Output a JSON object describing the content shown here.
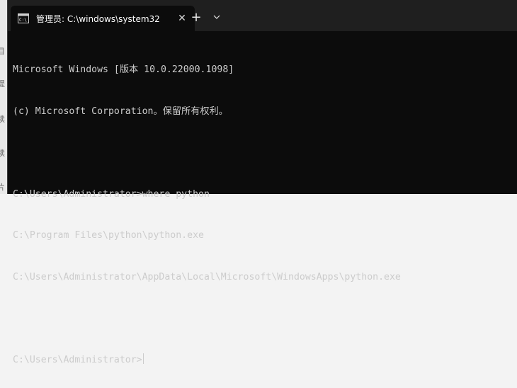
{
  "window": {
    "tab_title": "管理员: C:\\windows\\system32",
    "tab_close_icon": "close-icon",
    "new_tab_label": "+",
    "dropdown_icon": "chevron-down-icon"
  },
  "console": {
    "lines": [
      "Microsoft Windows [版本 10.0.22000.1098]",
      "(c) Microsoft Corporation。保留所有权利。",
      "",
      "C:\\Users\\Administrator>where python",
      "C:\\Program Files\\python\\python.exe",
      "C:\\Users\\Administrator\\AppData\\Local\\Microsoft\\WindowsApps\\python.exe",
      "",
      "C:\\Users\\Administrator>"
    ]
  },
  "background_window": {
    "glyphs": [
      "目",
      "提",
      "读",
      "读",
      "片"
    ]
  },
  "colors": {
    "console_bg": "#0c0c0c",
    "titlebar_bg": "#1f1f1f",
    "text": "#cccccc"
  }
}
